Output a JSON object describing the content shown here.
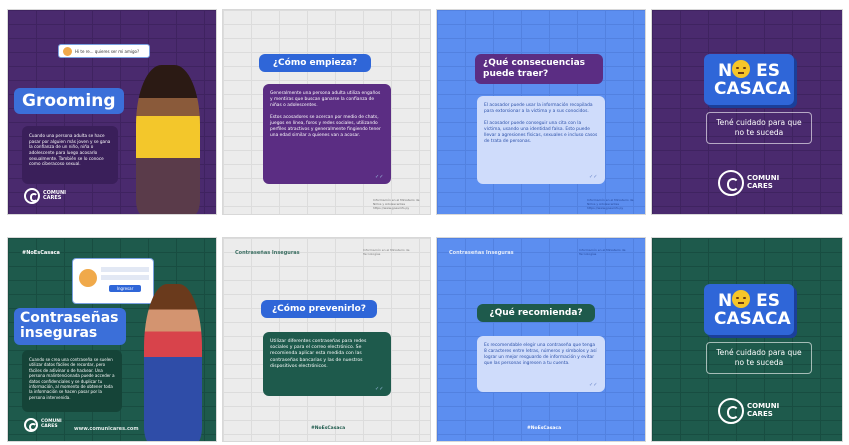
{
  "tiles": {
    "grooming": {
      "title": "Grooming",
      "chat_text": "Hi te re... quieres ser mi amigo?",
      "body": "Cuando una persona adulta se hace pasar por alguien más joven y se gana la confianza de un niño, niña o adolescente para luego acosarlo sexualmente. También se lo conoce como ciberacoso sexual.",
      "logo_line1": "COMUNI",
      "logo_line2": "CARES"
    },
    "como_empieza": {
      "title": "¿Cómo empieza?",
      "body": "Generalmente una persona adulta utiliza engaños y mentiras que buscan ganarse la confianza de niñas o adolescentes.\n\nEstos acosadores se acercan por medio de chats, juegos en línea, foros y redes sociales, utilizando perfiles atractivos y generalmente fingiendo tener una edad similar a quienes van a acosar.",
      "footer": "Información en el Ministerio de Niños y Adolescentes https://www.goesinfo.py"
    },
    "consecuencias": {
      "title": "¿Qué consecuencias puede traer?",
      "body": "El acosador puede usar la información recopilada para extorsionar a la víctima y a sus conocidos.\n\nEl acosador puede conseguir una cita con la víctima, usando una identidad falsa. Esto puede llevar a agresiones físicas, sexuales e incluso casos de trata de personas.",
      "footer": "Información en el Ministerio de Niños y Adolescentes https://www.goesinfo.py"
    },
    "no_es_casaca_1": {
      "line1a": "N",
      "line1b": "ES",
      "line2": "CASACA",
      "warning": "Tené cuidado para que no te suceda",
      "logo_line1": "COMUNI",
      "logo_line2": "CARES"
    },
    "contrasenas": {
      "hashtag": "#NoEsCasaca",
      "title": "Contraseñas inseguras",
      "login_label": "Ingresar",
      "body": "Cuando se crea una contraseña se suelen utilizar datos fáciles de recordar, pero fáciles de adivinar o de hackear. Una persona malintencionada puede acceder a datos confidenciales y se duplicar tu información, al momento de obtener toda la información se hacen pasar por la persona intervenida.",
      "website": "www.comunicares.com",
      "logo_line1": "COMUNI",
      "logo_line2": "CARES"
    },
    "como_prevenirlo": {
      "header": "Contraseñas Inseguras",
      "header_right": "Información en el Ministerio de Tecnologías",
      "title": "¿Cómo prevenirlo?",
      "body": "Utilizar diferentes contraseñas para redes sociales y para el correo electrónico. Se recomienda aplicar esta medida con las contraseñas bancarias y las de nuestros dispositivos electrónicos.",
      "hashtag": "#NoEsCasaca"
    },
    "recomienda": {
      "header": "Contraseñas Inseguras",
      "header_right": "Información en el Ministerio de Tecnologías",
      "title": "¿Qué recomienda?",
      "body": "Es recomendable elegir una contraseña que tenga 8 caracteres entre letras, números y símbolos y así lograr un mejor resguardo de información y evitar que las personas ingresen a tu cuenta.",
      "hashtag": "#NoEsCasaca"
    },
    "no_es_casaca_2": {
      "line1a": "N",
      "line1b": "ES",
      "line2": "CASACA",
      "warning": "Tené cuidado para que no te suceda",
      "logo_line1": "COMUNI",
      "logo_line2": "CARES"
    }
  },
  "colors": {
    "purple_dark": "#4a2a6e",
    "purple_box": "#5b2d83",
    "green_dark": "#1e5a4c",
    "blue_bg": "#5c8ef0",
    "blue_banner": "#2f66d8",
    "accent_yellow": "#f6c628"
  }
}
